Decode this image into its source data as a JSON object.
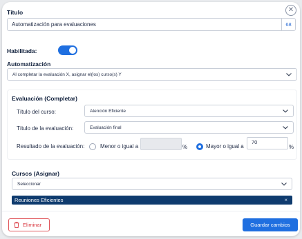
{
  "close_icon_glyph": "✕",
  "titulo": {
    "label": "Título",
    "value": "Automatización para evaluaciones",
    "char_count": "68"
  },
  "habilitada": {
    "label": "Habilitada:",
    "enabled": true
  },
  "automatizacion": {
    "label": "Automatización",
    "selected": "Al completar la evaluación X, asignar el(los) curso(s) Y"
  },
  "evaluacion": {
    "heading": "Evaluación (Completar)",
    "course_label": "Título del curso:",
    "course_value": "Atención Eficiente",
    "eval_label": "Título de la evaluación:",
    "eval_value": "Evaluación final",
    "result_label": "Resultado de la evaluación:",
    "option_less": "Menor o igual a",
    "option_less_value": "",
    "option_greater": "Mayor o igual a",
    "option_greater_value": "70",
    "percent_sign": "%",
    "selected_option": "greater"
  },
  "cursos": {
    "heading": "Cursos (Asignar)",
    "placeholder": "Seleccionar",
    "tags": [
      {
        "label": "Reuniones Eficientes",
        "remove_glyph": "×"
      }
    ]
  },
  "footer": {
    "delete_label": "Eliminar",
    "save_label": "Guardar cambios"
  },
  "colors": {
    "accent": "#1f6fe0",
    "danger": "#d9363e",
    "tag_bg": "#0f3b6e"
  }
}
